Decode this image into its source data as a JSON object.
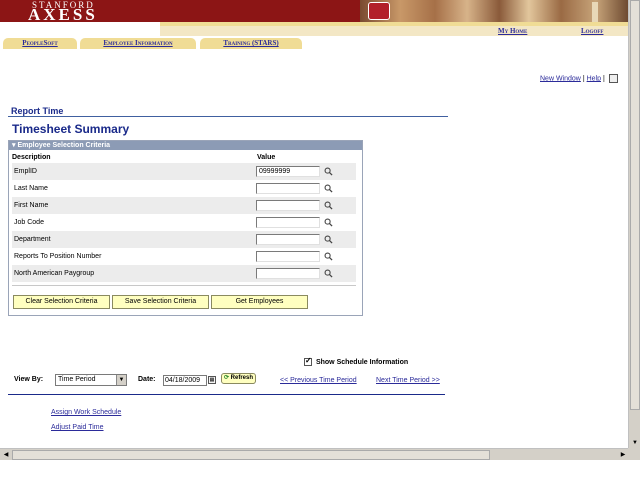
{
  "header": {
    "logo_top": "STANFORD",
    "logo_bottom": "AXESS",
    "my_home": "My Home",
    "logoff": "Logoff",
    "colors": {
      "brand": "#8c1515",
      "gold": "#f0dc95",
      "link": "#2b2b9a",
      "title": "#1a2a8a"
    }
  },
  "nav": {
    "tabs": [
      {
        "label": "PeopleSoft"
      },
      {
        "label": "Employee Information"
      },
      {
        "label": "Training (STARS)"
      }
    ]
  },
  "toplinks": {
    "new_window": "New Window",
    "help": "Help",
    "separator": "|",
    "print_icon": "print-icon"
  },
  "page": {
    "breadcrumb": "Report Time",
    "title": "Timesheet Summary"
  },
  "criteria": {
    "header": "Employee Selection Criteria",
    "col_description": "Description",
    "col_value": "Value",
    "rows": [
      {
        "label": "EmplID",
        "value": "09999999"
      },
      {
        "label": "Last Name",
        "value": ""
      },
      {
        "label": "First Name",
        "value": ""
      },
      {
        "label": "Job Code",
        "value": ""
      },
      {
        "label": "Department",
        "value": ""
      },
      {
        "label": "Reports To Position Number",
        "value": ""
      },
      {
        "label": "North American Paygroup",
        "value": ""
      }
    ],
    "buttons": {
      "clear": "Clear Selection Criteria",
      "save": "Save Selection Criteria",
      "get": "Get Employees"
    }
  },
  "controls": {
    "show_schedule": "Show Schedule Information",
    "show_schedule_checked": true,
    "view_by_label": "View By:",
    "view_by_value": "Time Period",
    "date_label": "Date:",
    "date_value": "04/18/2009",
    "refresh": "Refresh",
    "prev": "<< Previous Time Period",
    "next": "Next Time Period >>"
  },
  "actions": {
    "assign": "Assign Work Schedule",
    "adjust": "Adjust Paid Time"
  }
}
